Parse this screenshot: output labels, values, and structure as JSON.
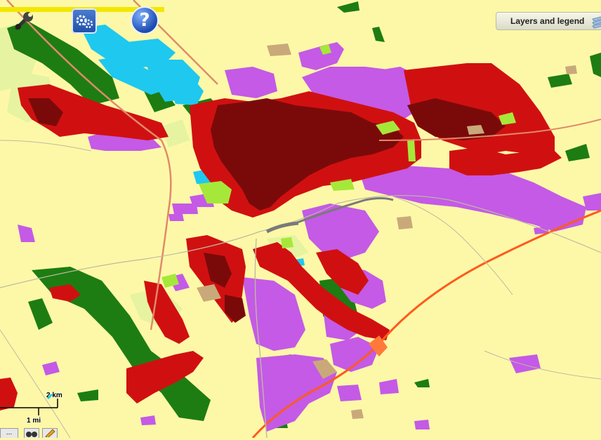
{
  "toolbar": {
    "tools_icon": "wrench-icon",
    "settings_icon": "gear-icon",
    "help_icon": "help-icon",
    "help_glyph": "?"
  },
  "layers_panel": {
    "label": "Layers and legend",
    "icon": "layers-icon"
  },
  "scale_bar": {
    "metric": "2 km",
    "imperial": "1 mi"
  },
  "bottom_tools": {
    "more_glyph": "...",
    "icons": [
      "binoculars-icon",
      "pencil-icon"
    ]
  },
  "map": {
    "land_use_colors": {
      "agricultural": "#fdf8a8",
      "residential_dense": "#7a0a0a",
      "residential": "#d01010",
      "industrial_commercial": "#c45ae6",
      "forest": "#1d7d12",
      "water": "#1ec8ef",
      "green_urban": "#a6e83a",
      "pasture": "#e6f3a0",
      "sport_leisure": "#c9a97a",
      "road_main": "#ff5a1e",
      "road_secondary": "#e08a6a",
      "railway": "#7a7a7a"
    }
  }
}
